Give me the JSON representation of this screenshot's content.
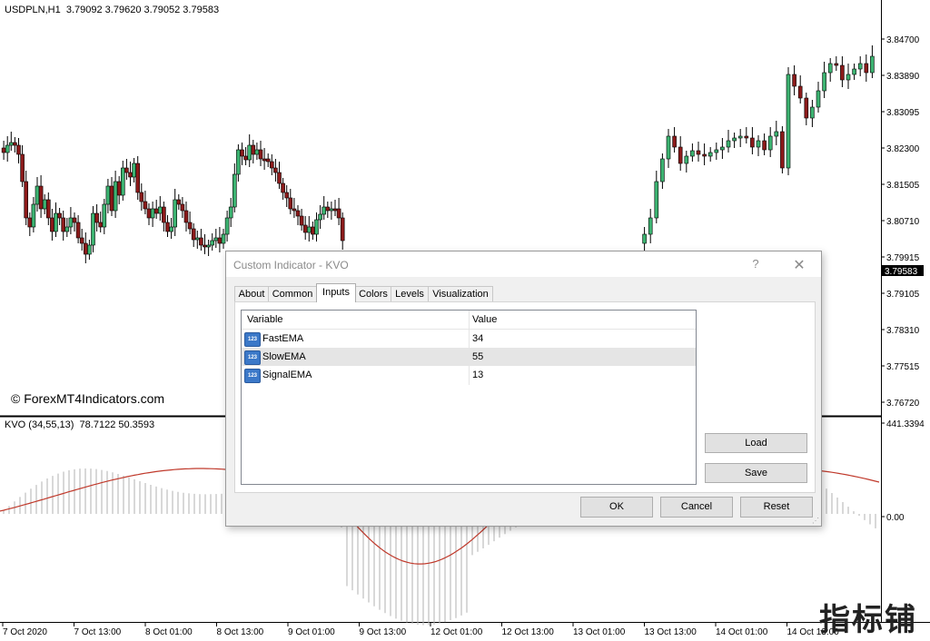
{
  "chart": {
    "symbol_info": "USDPLN,H1  3.79092 3.79620 3.79052 3.79583",
    "price_ticks": [
      "3.84700",
      "3.83890",
      "3.83095",
      "3.82300",
      "3.81505",
      "3.80710",
      "3.79915",
      "3.79105",
      "3.78310",
      "3.77515",
      "3.76720"
    ],
    "current_price": "3.79583",
    "indicator_info": "KVO (34,55,13)  78.7122 50.3593",
    "indicator_ticks": [
      "441.3394",
      "0.00"
    ],
    "time_ticks": [
      "7 Oct 2020",
      "7 Oct 13:00",
      "8 Oct 01:00",
      "8 Oct 13:00",
      "9 Oct 01:00",
      "9 Oct 13:00",
      "12 Oct 01:00",
      "12 Oct 13:00",
      "13 Oct 01:00",
      "13 Oct 13:00",
      "14 Oct 01:00",
      "14 Oct 13:00"
    ],
    "copyright": "© ForexMT4Indicators.com",
    "watermark": "指标铺",
    "colors": {
      "bull": "#3cb371",
      "bear": "#8b1a1a",
      "signal_line": "#c0392b",
      "histogram": "#b0b0b0"
    }
  },
  "dialog": {
    "title": "Custom Indicator - KVO",
    "help_icon": "?",
    "close_icon": "✕",
    "tabs": [
      "About",
      "Common",
      "Inputs",
      "Colors",
      "Levels",
      "Visualization"
    ],
    "active_tab": "Inputs",
    "table": {
      "headers": [
        "Variable",
        "Value"
      ],
      "rows": [
        {
          "name": "FastEMA",
          "value": "34",
          "icon": "123"
        },
        {
          "name": "SlowEMA",
          "value": "55",
          "icon": "123"
        },
        {
          "name": "SignalEMA",
          "value": "13",
          "icon": "123"
        }
      ]
    },
    "buttons": {
      "load": "Load",
      "save": "Save",
      "ok": "OK",
      "cancel": "Cancel",
      "reset": "Reset"
    }
  }
}
